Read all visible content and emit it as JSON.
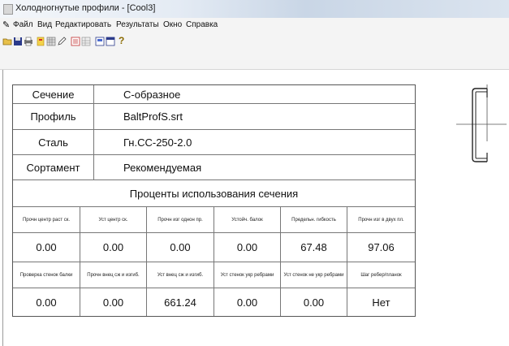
{
  "window": {
    "title": "Холодногнутые профили - [Cool3]"
  },
  "menu": {
    "items": [
      "Файл",
      "Вид",
      "Редактировать",
      "Результаты",
      "Окно",
      "Справка"
    ]
  },
  "toolbar": {
    "buttons": [
      "open-icon",
      "save-icon",
      "print-icon",
      "profile-icon",
      "grid-icon",
      "edit-icon",
      "list-icon",
      "table-icon",
      "report-icon",
      "window-icon",
      "help-icon"
    ],
    "help_glyph": "?"
  },
  "section_info": [
    {
      "label": "Сечение",
      "value": "С-образное"
    },
    {
      "label": "Профиль",
      "value": "BaltProfS.srt"
    },
    {
      "label": "Сталь",
      "value": "Гн.СС-250-2.0"
    },
    {
      "label": "Сортамент",
      "value": "Рекомендуемая"
    }
  ],
  "usage": {
    "title": "Проценты использования сечения",
    "row1_headers": [
      "Прочн центр раст ск.",
      "Уст центр ск.",
      "Прочн изг однон пр.",
      "Устойч. балок",
      "Предельн. гибкость",
      "Прочн изг в двух пл."
    ],
    "row1_values": [
      "0.00",
      "0.00",
      "0.00",
      "0.00",
      "67.48",
      "97.06"
    ],
    "row2_headers": [
      "Проверка стенок балки",
      "Прочн внец сж и изгиб.",
      "Уст внец сж и изгиб.",
      "Уст стенок укр ребрами",
      "Уст стенок не укр ребрами",
      "Шаг ребер/планок"
    ],
    "row2_values": [
      "0.00",
      "0.00",
      "661.24",
      "0.00",
      "0.00",
      "Нет"
    ]
  },
  "colors": {
    "border": "#555555",
    "titlebar": "#dbe4ef"
  }
}
